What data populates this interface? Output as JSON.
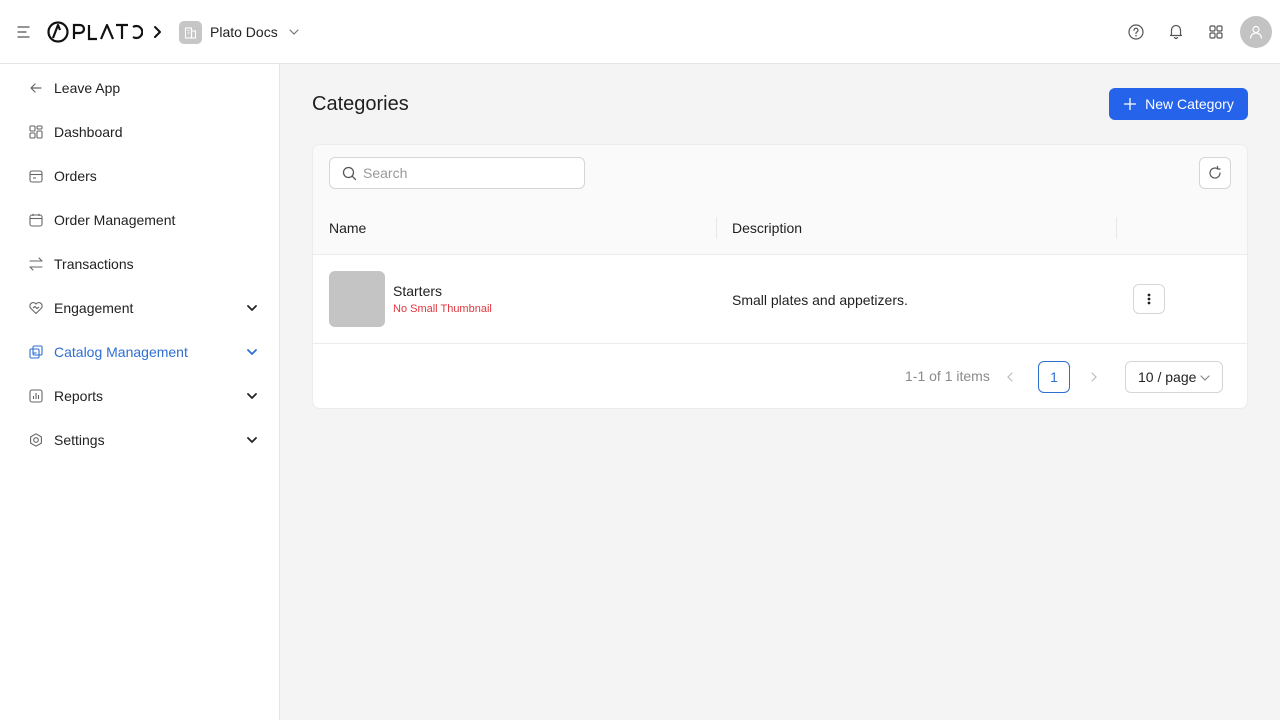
{
  "header": {
    "logo_text": "PLATO",
    "workspace_name": "Plato Docs",
    "icons": [
      "menu-fold-icon",
      "chevron-right-icon",
      "help-icon",
      "bell-icon",
      "apps-grid-icon",
      "user-icon"
    ]
  },
  "sidebar": {
    "items": [
      {
        "label": "Leave App",
        "icon": "arrow-left-icon"
      },
      {
        "label": "Dashboard",
        "icon": "dashboard-icon"
      },
      {
        "label": "Orders",
        "icon": "orders-icon"
      },
      {
        "label": "Order Management",
        "icon": "order-management-icon"
      },
      {
        "label": "Transactions",
        "icon": "swap-icon"
      },
      {
        "label": "Engagement",
        "icon": "heart-handshake-icon",
        "expandable": true
      },
      {
        "label": "Catalog Management",
        "icon": "catalog-icon",
        "expandable": true,
        "active": true
      },
      {
        "label": "Reports",
        "icon": "bar-chart-icon",
        "expandable": true
      },
      {
        "label": "Settings",
        "icon": "settings-icon",
        "expandable": true
      }
    ]
  },
  "main": {
    "title": "Categories",
    "new_button_label": "New Category",
    "search_placeholder": "Search",
    "columns": [
      "Name",
      "Description"
    ],
    "rows": [
      {
        "name": "Starters",
        "warning": "No Small Thumbnail",
        "description": "Small plates and appetizers."
      }
    ],
    "pagination": {
      "total_text": "1-1 of 1 items",
      "current_page": "1",
      "page_size": "10 / page"
    }
  },
  "colors": {
    "accent": "#2563eb",
    "active_nav": "#2f6fd1",
    "warning": "#e0383e"
  }
}
